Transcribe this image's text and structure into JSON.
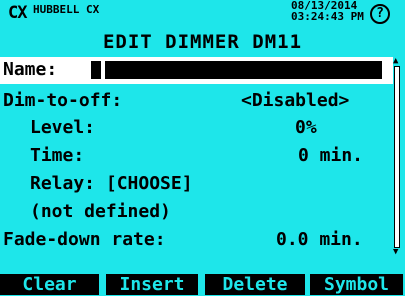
{
  "header": {
    "logo": "CX",
    "brand": "HUBBELL CX",
    "date": "08/13/2014",
    "time": "03:24:43 PM",
    "help_icon": "?"
  },
  "title": "EDIT DIMMER DM11",
  "name_field": {
    "label": "Name:",
    "value": ""
  },
  "settings": {
    "dim_to_off_label": "Dim-to-off:",
    "dim_to_off_value": "<Disabled>",
    "level_label": "Level:",
    "level_value": "0%",
    "time_label": "Time:",
    "time_value": "0 min.",
    "relay_label": "Relay: [CHOOSE]",
    "relay_status": "(not defined)",
    "fade_label": "Fade-down rate:",
    "fade_value": "0.0 min."
  },
  "softkeys": [
    "Clear",
    "Insert",
    "Delete",
    "Symbol"
  ],
  "colors": {
    "background": "#1ee6ea",
    "highlight": "#ffffff",
    "text": "#000000"
  }
}
